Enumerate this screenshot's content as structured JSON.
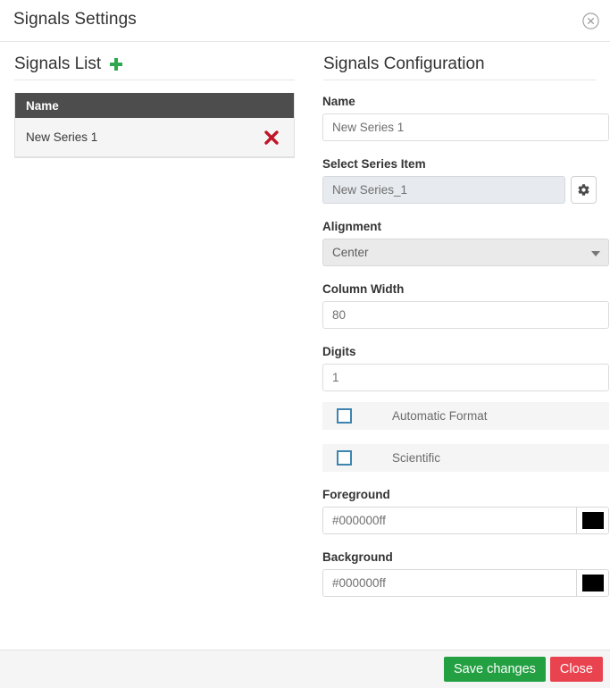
{
  "dialog": {
    "title": "Signals Settings",
    "close_icon": "close-circle-icon"
  },
  "signals_list": {
    "heading": "Signals List",
    "add_icon": "plus-icon",
    "columns": [
      "Name"
    ],
    "rows": [
      {
        "name": "New Series 1",
        "delete_icon": "x-delete-icon"
      }
    ]
  },
  "signals_configuration": {
    "heading": "Signals Configuration",
    "fields": {
      "name": {
        "label": "Name",
        "value": "New Series 1"
      },
      "select_series_item": {
        "label": "Select Series Item",
        "value": "New Series_1",
        "gear_icon": "gear-icon"
      },
      "alignment": {
        "label": "Alignment",
        "value": "Center",
        "caret_icon": "chevron-down-icon"
      },
      "column_width": {
        "label": "Column Width",
        "value": "80"
      },
      "digits": {
        "label": "Digits",
        "value": "1"
      },
      "automatic_format": {
        "label": "Automatic Format",
        "checked": false
      },
      "scientific": {
        "label": "Scientific",
        "checked": false
      },
      "foreground": {
        "label": "Foreground",
        "value": "#000000ff",
        "swatch_color": "#000000"
      },
      "background": {
        "label": "Background",
        "value": "#000000ff",
        "swatch_color": "#000000"
      }
    }
  },
  "footer": {
    "save_label": "Save changes",
    "close_label": "Close"
  }
}
